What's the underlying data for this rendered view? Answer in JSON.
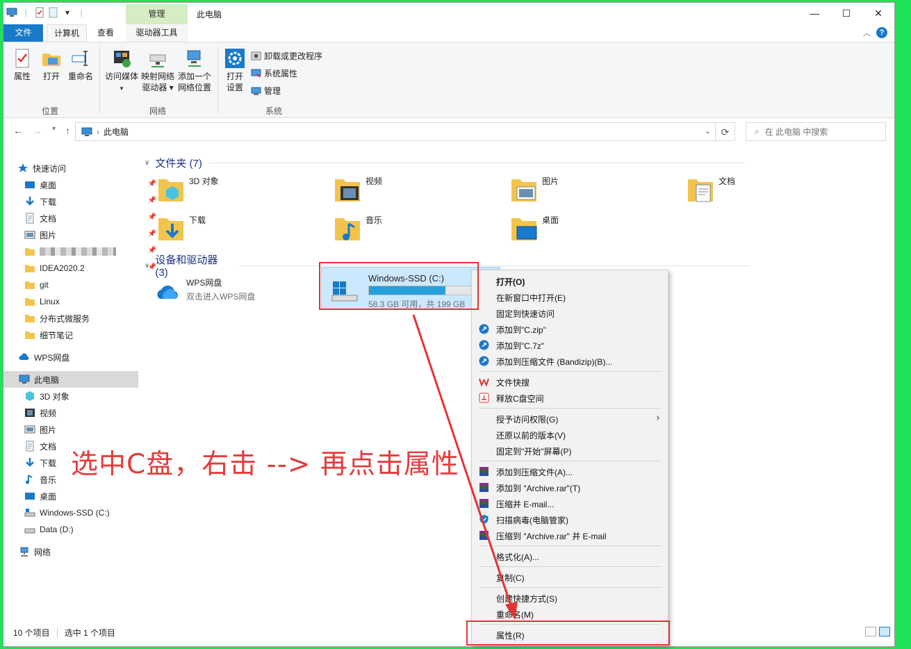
{
  "window": {
    "title": "此电脑",
    "context_tab_group": "管理",
    "controls": {
      "minimize": "—",
      "maximize": "☐",
      "close": "✕"
    }
  },
  "ribbon_tabs": {
    "file": "文件",
    "computer": "计算机",
    "view": "查看",
    "drive_tools": "驱动器工具",
    "help": "?"
  },
  "ribbon": {
    "location": {
      "label": "位置",
      "properties": "属性",
      "open": "打开",
      "rename": "重命名"
    },
    "network": {
      "label": "网络",
      "access_media": "访问媒体",
      "map_drive_l1": "映射网络",
      "map_drive_l2": "驱动器",
      "add_location_l1": "添加一个",
      "add_location_l2": "网络位置"
    },
    "system": {
      "label": "系统",
      "open_settings_l1": "打开",
      "open_settings_l2": "设置",
      "uninstall": "卸载或更改程序",
      "system_properties": "系统属性",
      "manage": "管理"
    }
  },
  "address": {
    "path": "此电脑",
    "search_placeholder": "在 此电脑 中搜索"
  },
  "nav_pane": {
    "quick_access": "快速访问",
    "quick_items": [
      {
        "label": "桌面",
        "icon": "desktop-icon",
        "pinned": true
      },
      {
        "label": "下载",
        "icon": "download-icon",
        "pinned": true
      },
      {
        "label": "文档",
        "icon": "documents-icon",
        "pinned": true
      },
      {
        "label": "图片",
        "icon": "pictures-icon",
        "pinned": true
      },
      {
        "label": "",
        "icon": "folder-icon",
        "pinned": true
      },
      {
        "label": "IDEA2020.2",
        "icon": "folder-icon",
        "pinned": true
      },
      {
        "label": "git",
        "icon": "folder-icon",
        "pinned": false
      },
      {
        "label": "Linux",
        "icon": "folder-icon",
        "pinned": false
      },
      {
        "label": "分布式微服务",
        "icon": "folder-icon",
        "pinned": false
      },
      {
        "label": "细节笔记",
        "icon": "folder-icon",
        "pinned": false
      }
    ],
    "wps": "WPS网盘",
    "this_pc": "此电脑",
    "pc_items": [
      {
        "label": "3D 对象",
        "icon": "3d-objects-icon"
      },
      {
        "label": "视频",
        "icon": "videos-icon"
      },
      {
        "label": "图片",
        "icon": "pictures-icon"
      },
      {
        "label": "文档",
        "icon": "documents-icon"
      },
      {
        "label": "下载",
        "icon": "download-icon"
      },
      {
        "label": "音乐",
        "icon": "music-icon"
      },
      {
        "label": "桌面",
        "icon": "desktop-icon"
      },
      {
        "label": "Windows-SSD (C:)",
        "icon": "drive-c-icon"
      },
      {
        "label": "Data (D:)",
        "icon": "drive-d-icon"
      }
    ],
    "network": "网络"
  },
  "content": {
    "folders_header": "文件夹 (7)",
    "folders": [
      {
        "label": "3D 对象",
        "icon": "3d-objects-icon"
      },
      {
        "label": "视频",
        "icon": "videos-icon"
      },
      {
        "label": "图片",
        "icon": "pictures-icon"
      },
      {
        "label": "文档",
        "icon": "documents-icon"
      },
      {
        "label": "下载",
        "icon": "download-icon"
      },
      {
        "label": "音乐",
        "icon": "music-icon"
      },
      {
        "label": "桌面",
        "icon": "desktop-icon"
      }
    ],
    "devices_header": "设备和驱动器 (3)",
    "wps": {
      "name": "WPS网盘",
      "desc": "双击进入WPS网盘"
    },
    "drive_c": {
      "name": "Windows-SSD (C:)",
      "size_text": "58.3 GB 可用，共 199 GB",
      "used_fraction": 0.707
    }
  },
  "status": {
    "count": "10 个项目",
    "selected": "选中 1 个项目"
  },
  "context_menu": {
    "open": "打开(O)",
    "open_new_window": "在新窗口中打开(E)",
    "pin_quick": "固定到快速访问",
    "add_czip": "添加到\"C.zip\"",
    "add_c7z": "添加到\"C.7z\"",
    "add_bandizip": "添加到压缩文件 (Bandizip)(B)...",
    "wps_search": "文件快搜",
    "free_c": "释放C盘空间",
    "grant_access": "授予访问权限(G)",
    "restore_versions": "还原以前的版本(V)",
    "pin_start": "固定到\"开始\"屏幕(P)",
    "add_archive": "添加到压缩文件(A)...",
    "add_archive_rar": "添加到 \"Archive.rar\"(T)",
    "compress_email": "压缩并 E-mail...",
    "scan_virus": "扫描病毒(电脑管家)",
    "compress_rar_email": "压缩到 \"Archive.rar\" 并 E-mail",
    "format": "格式化(A)...",
    "copy": "复制(C)",
    "create_shortcut": "创建快捷方式(S)",
    "rename": "重命名(M)",
    "properties": "属性(R)"
  },
  "annotation": "选中C盘，右击 --> 再点击属性",
  "colors": {
    "accent": "#1979ca",
    "annotation_red": "#e33434",
    "selection": "#cce8ff",
    "background": "#1fe25a"
  }
}
